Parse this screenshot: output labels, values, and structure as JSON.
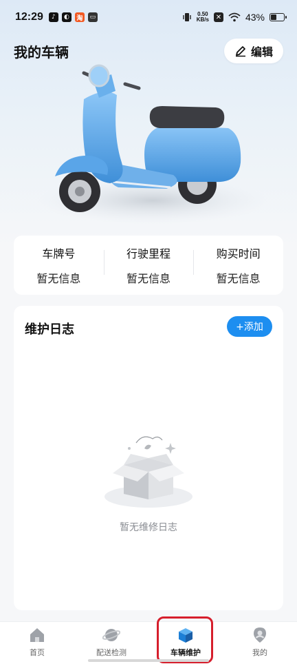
{
  "status_bar": {
    "time": "12:29",
    "net_speed_value": "0.50",
    "net_speed_unit": "KB/s",
    "battery_percent": "43%",
    "battery_level": 0.43
  },
  "header": {
    "title": "我的车辆",
    "edit_label": "编辑"
  },
  "vehicle_info": [
    {
      "label": "车牌号",
      "value": "暂无信息"
    },
    {
      "label": "行驶里程",
      "value": "暂无信息"
    },
    {
      "label": "购买时间",
      "value": "暂无信息"
    }
  ],
  "maintenance_log": {
    "title": "维护日志",
    "add_label": "+添加",
    "empty_text": "暂无维修日志"
  },
  "tab_bar": {
    "tabs": [
      {
        "label": "首页",
        "icon": "home-icon"
      },
      {
        "label": "配送检测",
        "icon": "planet-icon"
      },
      {
        "label": "车辆维护",
        "icon": "cube-icon",
        "active": true
      },
      {
        "label": "我的",
        "icon": "profile-icon"
      }
    ]
  },
  "colors": {
    "accent": "#1d8ef0",
    "scooter_body": "#5ba8ea",
    "highlight_border": "#d61e2c"
  }
}
